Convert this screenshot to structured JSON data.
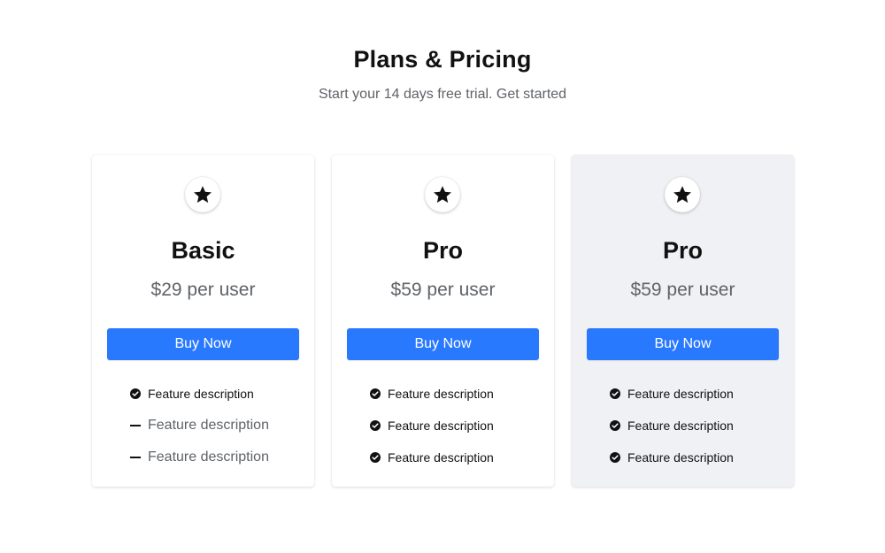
{
  "header": {
    "title": "Plans & Pricing",
    "subtitle": "Start your 14 days free trial. Get started"
  },
  "colors": {
    "accent": "#2979ff",
    "highlight_card": "#f0f1f5"
  },
  "plans": [
    {
      "icon": "star-icon",
      "name": "Basic",
      "price": "$29 per user",
      "button": "Buy Now",
      "features": [
        {
          "label": "Feature description",
          "included": true
        },
        {
          "label": "Feature description",
          "included": false
        },
        {
          "label": "Feature description",
          "included": false
        }
      ]
    },
    {
      "icon": "star-icon",
      "name": "Pro",
      "price": "$59 per user",
      "button": "Buy Now",
      "features": [
        {
          "label": "Feature description",
          "included": true
        },
        {
          "label": "Feature description",
          "included": true
        },
        {
          "label": "Feature description",
          "included": true
        }
      ]
    },
    {
      "icon": "star-icon",
      "name": "Pro",
      "price": "$59 per user",
      "button": "Buy Now",
      "highlighted": true,
      "features": [
        {
          "label": "Feature description",
          "included": true
        },
        {
          "label": "Feature description",
          "included": true
        },
        {
          "label": "Feature description",
          "included": true
        }
      ]
    }
  ]
}
